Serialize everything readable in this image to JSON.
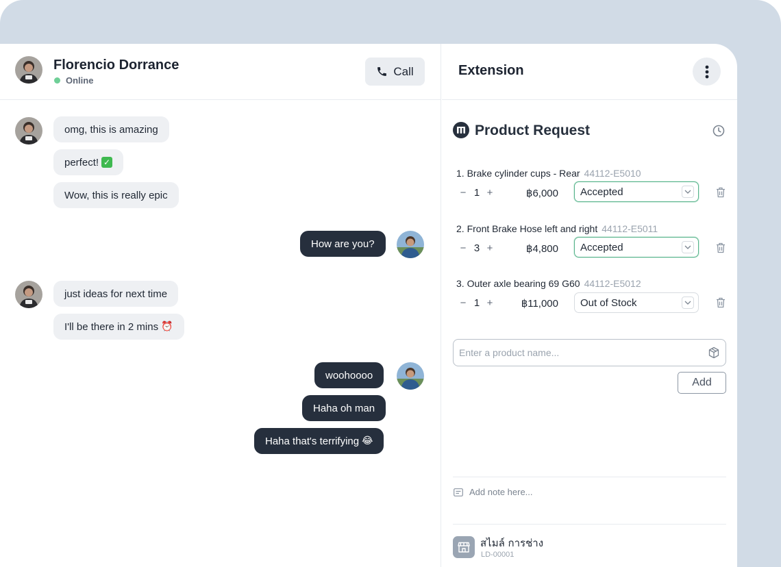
{
  "chat": {
    "contact_name": "Florencio Dorrance",
    "status": "Online",
    "call_label": "Call",
    "messages": {
      "m1": "omg, this is amazing",
      "m2": "perfect!",
      "m3": "Wow, this is really epic",
      "m4": "How are you?",
      "m5": "just ideas for next time",
      "m6": "I'll be there in 2 mins",
      "m7": "woohoooo",
      "m8": "Haha oh man",
      "m9": "Haha that's terrifying"
    }
  },
  "extension": {
    "title": "Extension",
    "section_title": "Product Request",
    "items": [
      {
        "label": "1. Brake cylinder cups - Rear",
        "code": "44112-E5010",
        "qty": "1",
        "price": "฿6,000",
        "status": "Accepted"
      },
      {
        "label": "2. Front Brake Hose left and right",
        "code": "44112-E5011",
        "qty": "3",
        "price": "฿4,800",
        "status": "Accepted"
      },
      {
        "label": "3. Outer axle bearing 69 G60",
        "code": "44112-E5012",
        "qty": "1",
        "price": "฿11,000",
        "status": "Out of Stock"
      }
    ],
    "qty_minus": "−",
    "qty_plus": "+",
    "product_placeholder": "Enter a product name...",
    "add_label": "Add",
    "note_placeholder": "Add note here...",
    "shop": {
      "name": "สไมล์ การช่าง",
      "id": "LD-00001"
    }
  },
  "colors": {
    "accent_accepted": "#58b38c",
    "online": "#6fcf97",
    "outgoing_bubble": "#262f3d",
    "incoming_bubble": "#eef0f3",
    "frame": "#d1dbe6"
  },
  "icons": [
    "phone-icon",
    "more-vertical-icon",
    "brand-logo-icon",
    "history-icon",
    "chevron-down-icon",
    "trash-icon",
    "box-icon",
    "note-icon",
    "shop-icon"
  ]
}
